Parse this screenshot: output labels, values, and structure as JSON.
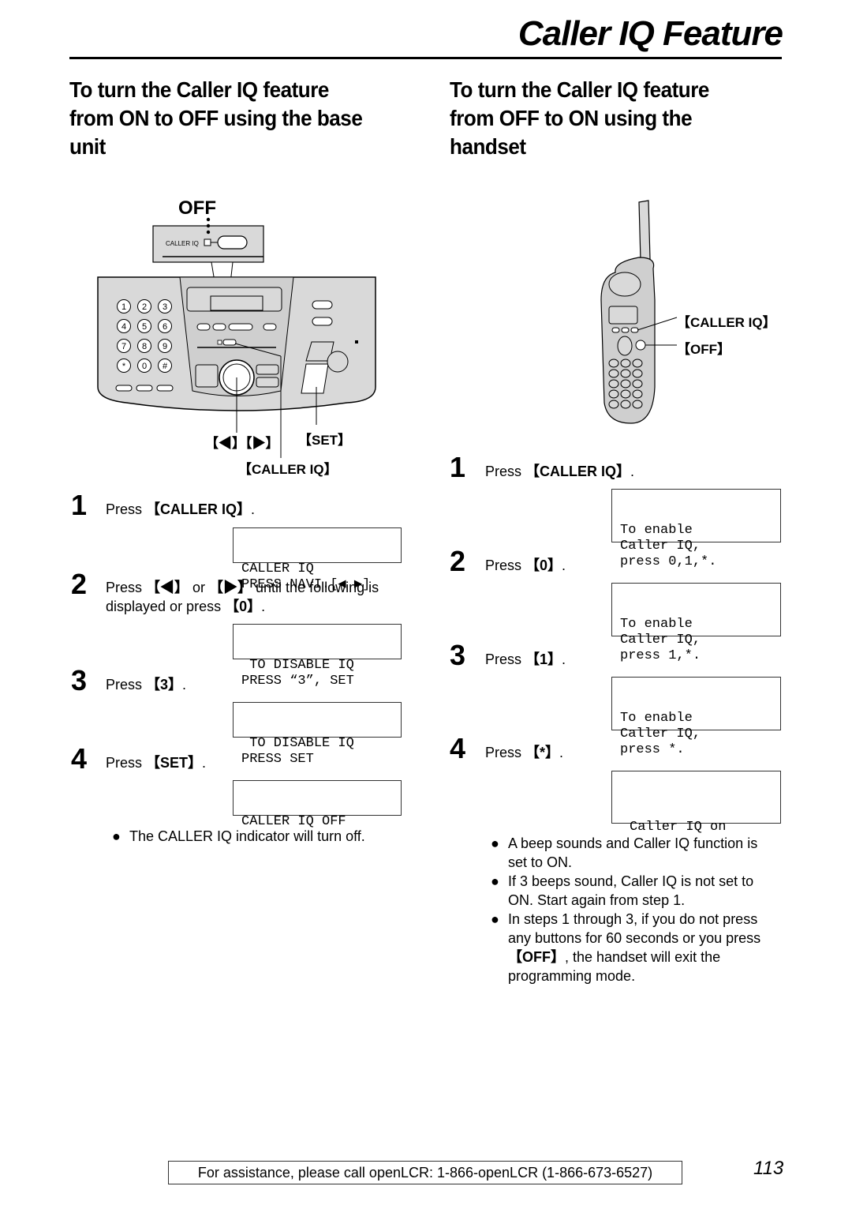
{
  "header": {
    "title": "Caller IQ Feature"
  },
  "left_section": {
    "heading": [
      "To turn the Caller IQ feature",
      "from ON to OFF using the base",
      "unit"
    ],
    "diagram": {
      "off_label": "OFF",
      "panel_label": "CALLER IQ",
      "keypad": [
        "1",
        "2",
        "3",
        "4",
        "5",
        "6",
        "7",
        "8",
        "9",
        "*",
        "0",
        "#"
      ],
      "callout_navi": "【◀】【▶】",
      "callout_set": "【SET】",
      "callout_caller_iq": "【CALLER IQ】"
    },
    "steps": [
      {
        "num": "1",
        "pre": "Press ",
        "key": "【CALLER IQ】",
        "post": ".",
        "display": [
          "CALLER IQ",
          "PRESS NAVI.[◀ ▶]"
        ]
      },
      {
        "num": "2",
        "pre": "Press ",
        "key": "【◀】",
        "mid": " or ",
        "key2": "【▶】",
        "post": " until the following is",
        "line2_pre": "displayed or press ",
        "line2_key": "【0】",
        "line2_post": ".",
        "display": [
          " TO DISABLE IQ",
          "PRESS “3”, SET"
        ]
      },
      {
        "num": "3",
        "pre": "Press ",
        "key": "【3】",
        "post": ".",
        "display": [
          " TO DISABLE IQ",
          "PRESS SET"
        ]
      },
      {
        "num": "4",
        "pre": "Press ",
        "key": "【SET】",
        "post": ".",
        "display": [
          "CALLER IQ OFF",
          ""
        ]
      }
    ],
    "note": "The CALLER IQ indicator will turn off."
  },
  "right_section": {
    "heading": [
      "To turn the Caller IQ feature",
      "from OFF to ON using the",
      "handset"
    ],
    "diagram": {
      "callout_caller_iq": "【CALLER IQ】",
      "callout_off": "【OFF】"
    },
    "steps": [
      {
        "num": "1",
        "pre": "Press ",
        "key": "【CALLER IQ】",
        "post": ".",
        "display": [
          "To enable",
          "Caller IQ,",
          "press 0,1,*."
        ]
      },
      {
        "num": "2",
        "pre": "Press ",
        "key": "【0】",
        "post": ".",
        "display": [
          "To enable",
          "Caller IQ,",
          "press 1,*."
        ]
      },
      {
        "num": "3",
        "pre": "Press ",
        "key": "【1】",
        "post": ".",
        "display": [
          "To enable",
          "Caller IQ,",
          "press *."
        ]
      },
      {
        "num": "4",
        "pre": "Press ",
        "key": "【*】",
        "post": ".",
        "display": [
          "Caller IQ on"
        ]
      }
    ],
    "notes": [
      {
        "lines": [
          "A beep sounds and Caller IQ function is",
          "set to ON."
        ]
      },
      {
        "lines": [
          "If 3 beeps sound, Caller IQ is not set to",
          "ON. Start again from step 1."
        ]
      },
      {
        "lines": [
          "In steps 1 through 3, if you do not press",
          "any buttons for 60 seconds or you press"
        ],
        "key": "【OFF】",
        "after": ", the handset will exit the",
        "last": "programming mode."
      }
    ]
  },
  "footer": {
    "assistance": "For assistance, please call openLCR: 1-866-openLCR (1-866-673-6527)",
    "page_number": "113"
  }
}
